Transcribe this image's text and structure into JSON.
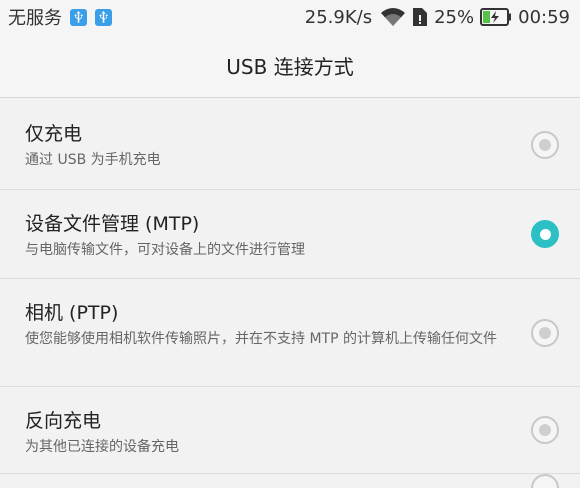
{
  "status_bar": {
    "carrier": "无服务",
    "icons": [
      "usb-icon",
      "usb-icon"
    ],
    "net_speed": "25.9K/s",
    "battery_percent": "25%",
    "time": "00:59",
    "battery_level": 0.25,
    "accent_color": "#3a9ee8"
  },
  "header": {
    "title": "USB 连接方式"
  },
  "options": [
    {
      "title": "仅充电",
      "description": "通过 USB 为手机充电",
      "selected": false
    },
    {
      "title": "设备文件管理 (MTP)",
      "description": "与电脑传输文件，可对设备上的文件进行管理",
      "selected": true
    },
    {
      "title": "相机 (PTP)",
      "description": "使您能够使用相机软件传输照片，并在不支持 MTP 的计算机上传输任何文件",
      "selected": false
    },
    {
      "title": "反向充电",
      "description": "为其他已连接的设备充电",
      "selected": false
    }
  ],
  "colors": {
    "selected_radio": "#2cbfc4",
    "background": "#f2f2f2"
  }
}
